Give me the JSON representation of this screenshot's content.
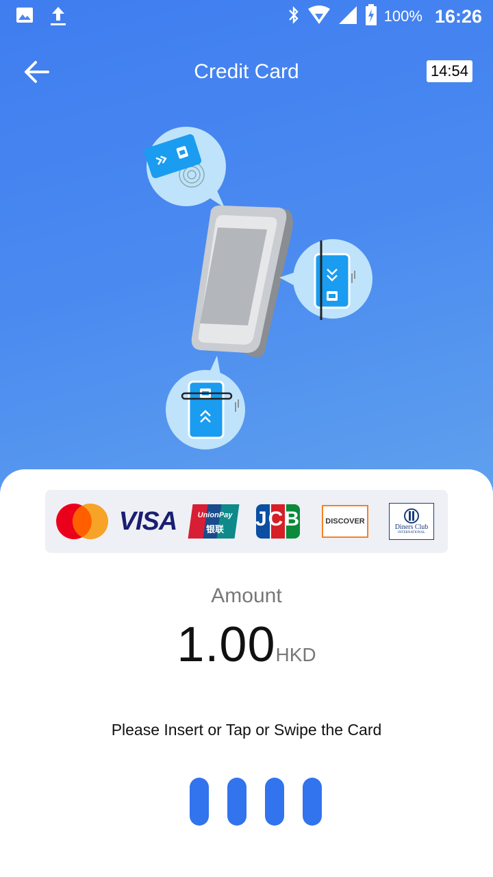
{
  "colors": {
    "accent": "#3273ee",
    "header_gradient_start": "#3f7df0",
    "header_gradient_end": "#5fa0ee"
  },
  "status_bar": {
    "icons_left": [
      "image-icon",
      "upload-icon"
    ],
    "icons_right": [
      "bluetooth-icon",
      "wifi-icon",
      "signal-icon",
      "battery-charging-icon"
    ],
    "battery": "100%",
    "time": "16:26"
  },
  "app_bar": {
    "back_icon": "arrow-left-icon",
    "title": "Credit Card",
    "countdown": "14:54"
  },
  "card_brands": [
    "Mastercard",
    "VISA",
    "UnionPay",
    "JCB",
    "DISCOVER",
    "Diners Club"
  ],
  "logo_text": {
    "visa": "VISA",
    "unionpay": "UnionPay",
    "unionpay_cn": "银联",
    "jcb": "JCB",
    "discover": "DISCOVER",
    "diners_line1": "Diners Club",
    "diners_line2": "INTERNATIONAL"
  },
  "payment": {
    "amount_label": "Amount",
    "amount_value": "1.00",
    "currency": "HKD",
    "instruction": "Please Insert or Tap or Swipe the Card"
  }
}
